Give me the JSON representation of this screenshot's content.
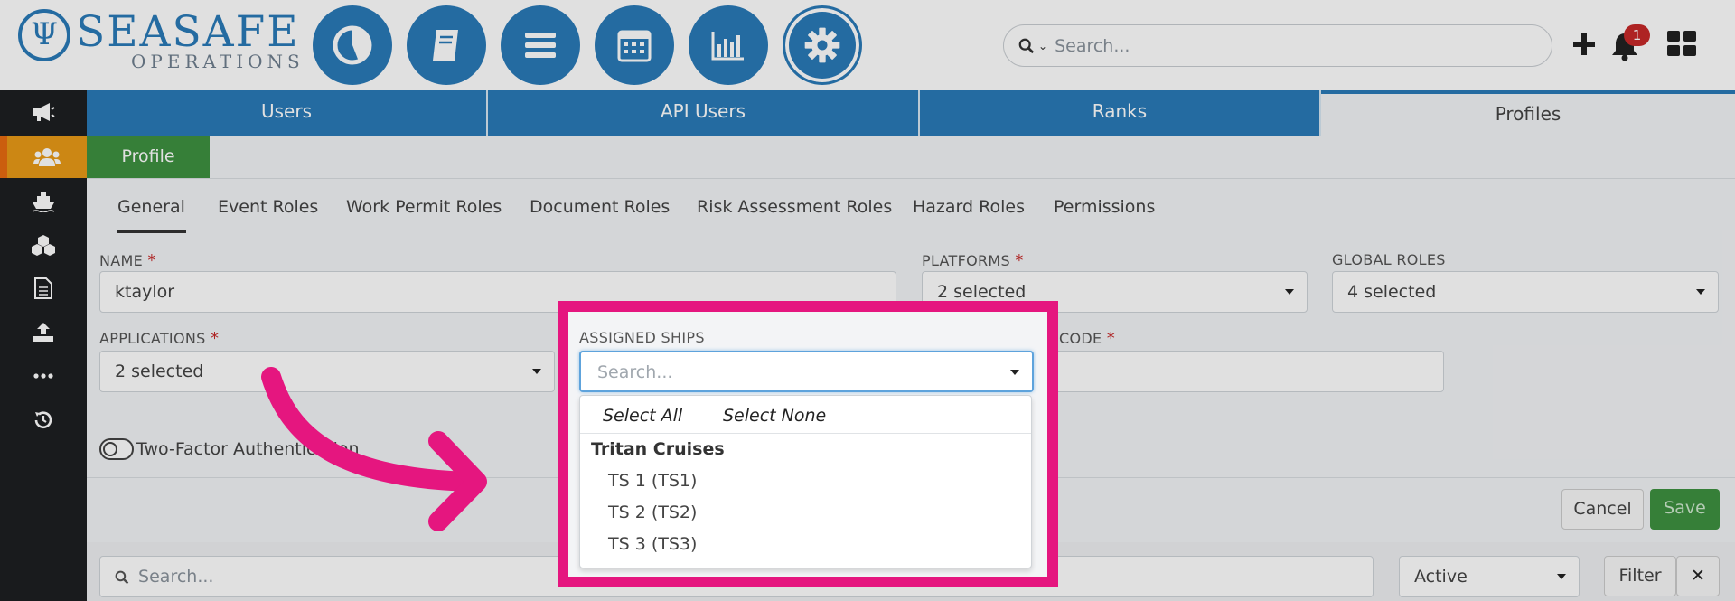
{
  "brand": {
    "logo_text": "SEASAFE",
    "logo_sub": "OPERATIONS",
    "logo_mark": "Ψ"
  },
  "top_nav": {
    "icons": [
      "dashboard-pie-icon",
      "book-icon",
      "menu-icon",
      "calendar-icon",
      "bar-chart-icon",
      "gear-icon"
    ],
    "search_placeholder": "Search...",
    "notification_count": "1"
  },
  "main_tabs": [
    "Users",
    "API Users",
    "Ranks",
    "Profiles"
  ],
  "sidebar_icons": [
    "megaphone-icon",
    "users-icon",
    "ship-icon",
    "cubes-icon",
    "document-icon",
    "upload-icon",
    "more-icon",
    "history-icon"
  ],
  "profile_tab": "Profile",
  "sub_tabs": [
    "General",
    "Event Roles",
    "Work Permit Roles",
    "Document Roles",
    "Risk Assessment Roles",
    "Hazard Roles",
    "Permissions"
  ],
  "form": {
    "name_label": "NAME",
    "name_value": "ktaylor",
    "platforms_label": "PLATFORMS",
    "platforms_value": "2 selected",
    "global_roles_label": "GLOBAL ROLES",
    "global_roles_value": "4 selected",
    "applications_label": "APPLICATIONS",
    "applications_value": "2 selected",
    "code_label": "CODE",
    "two_factor_label": "Two-Factor Authentication",
    "cancel": "Cancel",
    "save": "Save"
  },
  "list_bar": {
    "search_placeholder": "Search...",
    "status_value": "Active",
    "filter": "Filter",
    "clear": "✕"
  },
  "assigned_ships": {
    "label": "ASSIGNED SHIPS",
    "search_placeholder": "Search...",
    "select_all": "Select All",
    "select_none": "Select None",
    "group": "Tritan Cruises",
    "options": [
      "TS 1 (TS1)",
      "TS 2 (TS2)",
      "TS 3 (TS3)"
    ]
  },
  "colors": {
    "brand_blue": "#2a7ab8",
    "highlight": "#e5167f",
    "save_green": "#3e9140",
    "sidebar_dark": "#1d1f21",
    "sidebar_active": "#e99a17"
  }
}
